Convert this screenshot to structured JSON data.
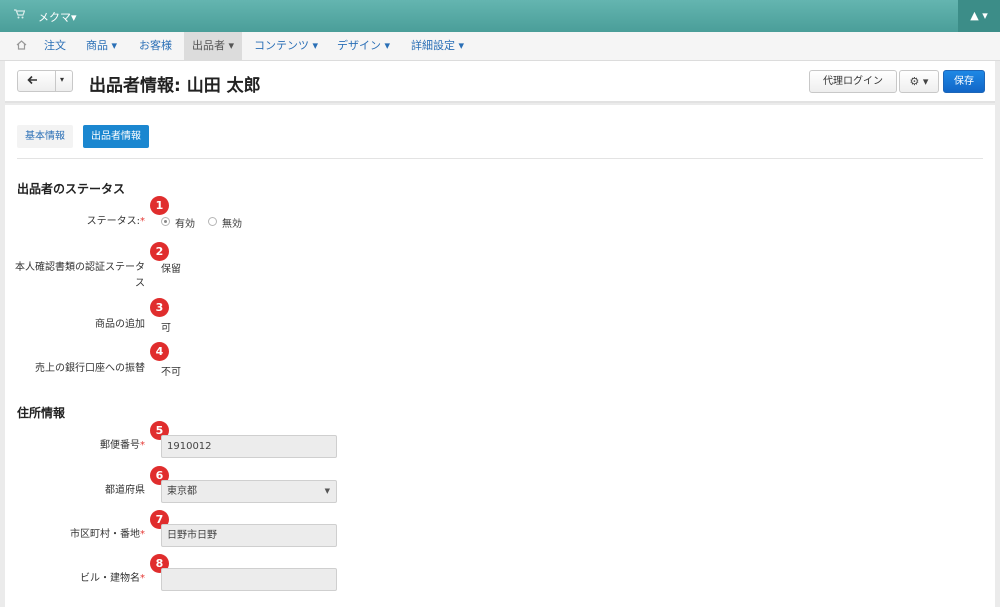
{
  "topbar": {
    "store_name": "メクマ▾",
    "cart_icon": "cart-icon",
    "user_icon": "user-icon",
    "user_menu": "▲ ▾"
  },
  "menu": {
    "home_icon": "home-icon",
    "items": [
      {
        "label": "注文"
      },
      {
        "label": "商品 ▾"
      },
      {
        "label": "お客様"
      },
      {
        "label": "出品者 ▾",
        "active": true
      },
      {
        "label": "コンテンツ ▾"
      },
      {
        "label": "デザイン ▾"
      },
      {
        "label": "詳細設定 ▾"
      }
    ]
  },
  "header": {
    "title": "出品者情報: 山田 太郎",
    "proxy_login": "代理ログイン",
    "gear_label": "⚙ ▾",
    "save": "保存",
    "back_arrow": "🡐",
    "back_caret": "▾"
  },
  "tabs": [
    {
      "label": "基本情報",
      "active": false
    },
    {
      "label": "出品者情報",
      "active": true
    }
  ],
  "status_section": {
    "title": "出品者のステータス",
    "status": {
      "label": "ステータス:",
      "required": "*",
      "options": [
        "有効",
        "無効"
      ],
      "selected": "有効",
      "badge": "1"
    },
    "id_verification": {
      "label": "本人確認書類の認証ステータス",
      "value": "保留",
      "badge": "2"
    },
    "add_products": {
      "label": "商品の追加",
      "value": "可",
      "badge": "3"
    },
    "bank_transfer": {
      "label": "売上の銀行口座への振替",
      "value": "不可",
      "badge": "4"
    }
  },
  "address_section": {
    "title": "住所情報",
    "postal_code": {
      "label": "郵便番号",
      "required": "*",
      "value": "1910012",
      "badge": "5"
    },
    "prefecture": {
      "label": "都道府県",
      "value": "東京都",
      "caret": "▼",
      "badge": "6"
    },
    "city": {
      "label": "市区町村・番地",
      "required": "*",
      "value": "日野市日野",
      "badge": "7"
    },
    "building": {
      "label": "ビル・建物名",
      "required": "*",
      "value": "",
      "badge": "8"
    }
  },
  "colors": {
    "topbar": "#55a8a3",
    "primary": "#1b87d0",
    "badge": "#e02d2d",
    "required": "#e53935"
  }
}
